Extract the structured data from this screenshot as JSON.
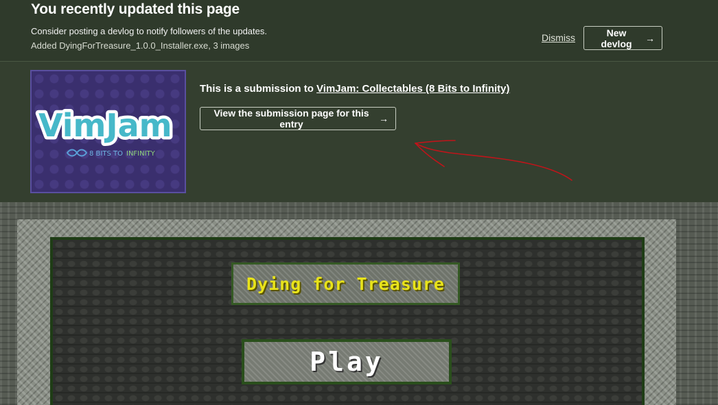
{
  "banner": {
    "title": "You recently updated this page",
    "description": "Consider posting a devlog to notify followers of the updates.",
    "files_line": "Added DyingForTreasure_1.0.0_Installer.exe, 3 images",
    "dismiss_label": "Dismiss",
    "new_devlog_label": "New devlog",
    "arrow": "→"
  },
  "submission": {
    "prefix": "This is a submission to ",
    "jam_name": "VimJam: Collectables (8 Bits to Infinity)",
    "view_button_label": "View the submission page for this entry",
    "arrow": "→",
    "thumbnail": {
      "logo_text": "VimJam",
      "logo_subtext_a": "8 BITS TO",
      "logo_subtext_b": "INFINITY"
    }
  },
  "game": {
    "title": "Dying for Treasure",
    "play_label": "Play"
  },
  "colors": {
    "banner_bg": "#2f3a2b",
    "strip_bg": "#343f2f",
    "game_title_yellow": "#e8e31a",
    "annotation_red": "#c0141a"
  }
}
